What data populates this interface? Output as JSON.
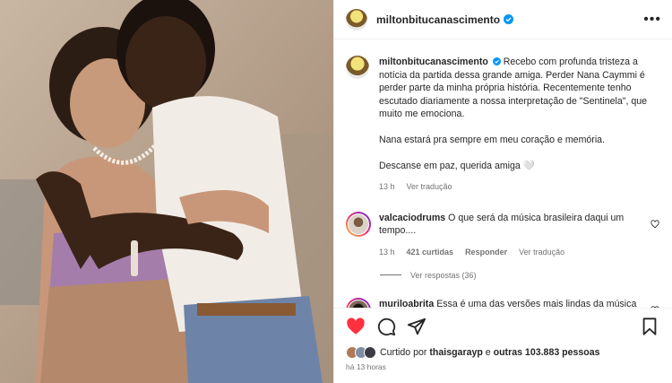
{
  "post": {
    "author": "miltonbitucanascimento",
    "more_icon": "more-horizontal-icon"
  },
  "caption": {
    "author": "miltonbitucanascimento",
    "paragraph1": "Recebo com profunda tristeza a notícia da partida dessa grande amiga. Perder Nana Caymmi é perder parte da minha própria história. Recentemente tenho escutado diariamente a nossa interpretação de \"Sentinela\", que muito me emociona.",
    "paragraph2": "Nana estará pra sempre em meu coração e memória.",
    "paragraph3": "Descanse em paz, querida amiga 🤍",
    "time": "13 h",
    "translate": "Ver tradução"
  },
  "comments": [
    {
      "author": "valcaciodrums",
      "text": "O que será da música brasileira daqui um tempo....",
      "time": "13 h",
      "likes": "421 curtidas",
      "reply": "Responder",
      "translate": "Ver tradução",
      "view_replies": "Ver respostas (36)"
    },
    {
      "author": "muriloabrita",
      "text": "Essa é uma das versões mais lindas da música brasileira! Meus sentimentos, Bitucal. ❤"
    }
  ],
  "likes": {
    "prefix": "Curtido por ",
    "user": "thaisgarayp",
    "middle": " e ",
    "others": "outras 103.883 pessoas"
  },
  "posted_ago": "há 13 horas",
  "colors": {
    "heart_red": "#ff3040",
    "verified_blue": "#0095f6",
    "secondary_text": "#737373"
  }
}
